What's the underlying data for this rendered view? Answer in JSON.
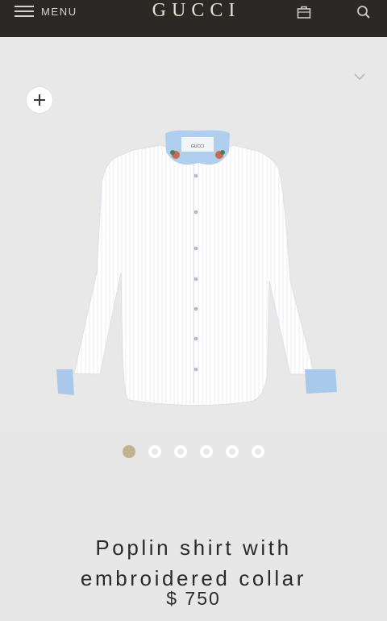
{
  "header": {
    "menu_label": "MENU",
    "logo": "GUCCI",
    "icons": [
      "menu-icon",
      "shopping-bag-icon",
      "search-icon"
    ]
  },
  "product": {
    "name_line1": "Poplin shirt with",
    "name_line2": "embroidered collar",
    "price": "$ 750",
    "collar_text": "GUCCI"
  },
  "gallery": {
    "image_count": 6,
    "active_index": 0
  },
  "colors": {
    "header_bg": "#2b2926",
    "logo": "#e9e2d3",
    "background": "#e7e7e7",
    "active_dot": "#c3b28f",
    "collar_blue": "#a9c9ea"
  }
}
